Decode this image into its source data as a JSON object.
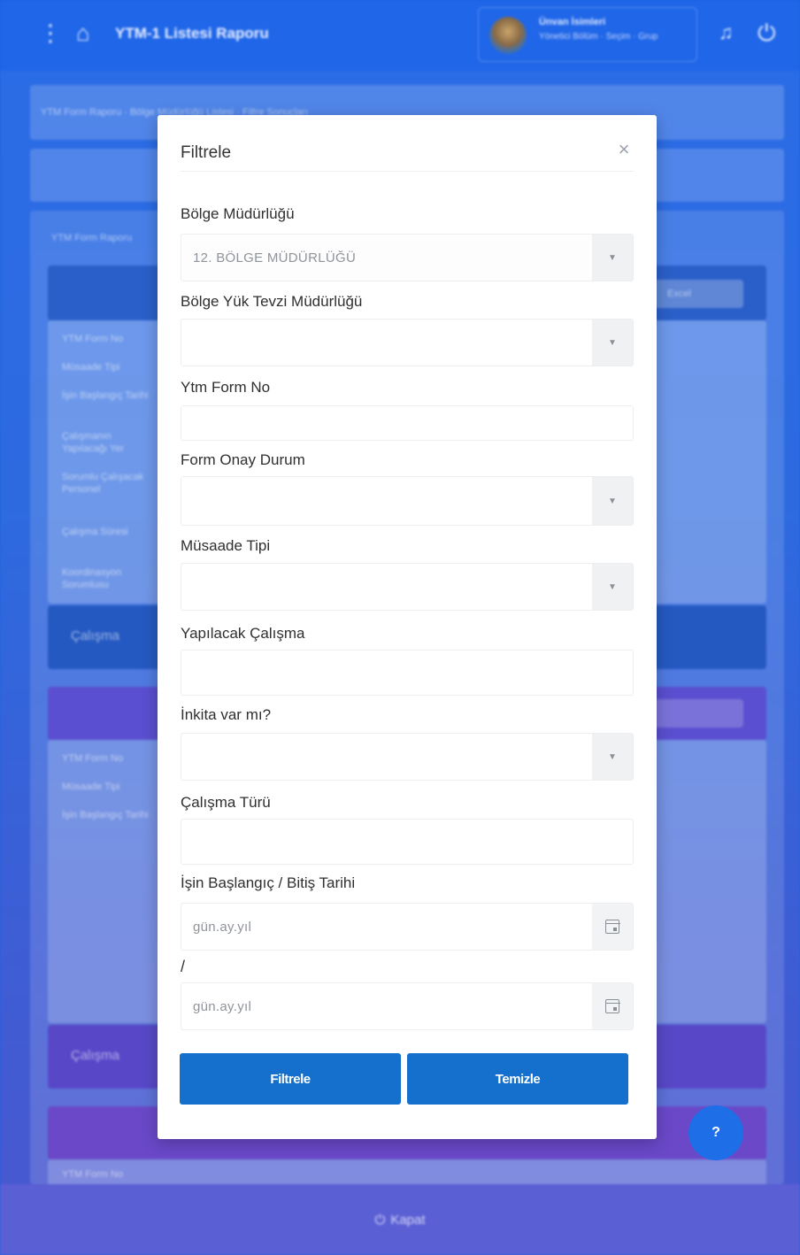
{
  "app": {
    "title": "YTM-1 Listesi Raporu",
    "user_name": "Ünvan İsimleri",
    "user_sub": "Yönetici Bölüm · Seçim · Grup",
    "bottom_close": "Kapat",
    "help": "?"
  },
  "background": {
    "breadcrumb": "YTM Form Raporu · Bölge Müdürlüğü Listesi · Filtre Sonuçları",
    "subheader": "YTM Form Raporu",
    "card_button": "Excel",
    "rows": [
      "YTM Form No",
      "Müsaade Tipi",
      "İşin Başlangıç Tarihi",
      "Çalışmanın Yapılacağı Yer",
      "Sorumlu Çalışacak Personel",
      "Çalışma Süresi",
      "Koordinasyon Sorumlusu"
    ],
    "section_label": "Çalışma"
  },
  "modal": {
    "title": "Filtrele",
    "fields": {
      "bolge_mudurlugu": {
        "label": "Bölge Müdürlüğü",
        "value": "12. BÖLGE MÜDÜRLÜĞÜ"
      },
      "yuk_tevzi": {
        "label": "Bölge Yük Tevzi Müdürlüğü",
        "value": ""
      },
      "ytm_form_no": {
        "label": "Ytm Form No",
        "value": ""
      },
      "form_onay": {
        "label": "Form Onay Durum",
        "value": ""
      },
      "musaade_tipi": {
        "label": "Müsaade Tipi",
        "value": ""
      },
      "yapilacak_calisma": {
        "label": "Yapılacak Çalışma",
        "value": ""
      },
      "inkita": {
        "label": "İnkita var mı?",
        "value": ""
      },
      "calisma_turu": {
        "label": "Çalışma Türü",
        "value": ""
      },
      "tarih": {
        "label": "İşin Başlangıç / Bitiş Tarihi",
        "start_placeholder": "gün.ay.yıl",
        "separator": "/",
        "end_placeholder": "gün.ay.yıl"
      }
    },
    "buttons": {
      "filter": "Filtrele",
      "clear": "Temizle"
    }
  }
}
